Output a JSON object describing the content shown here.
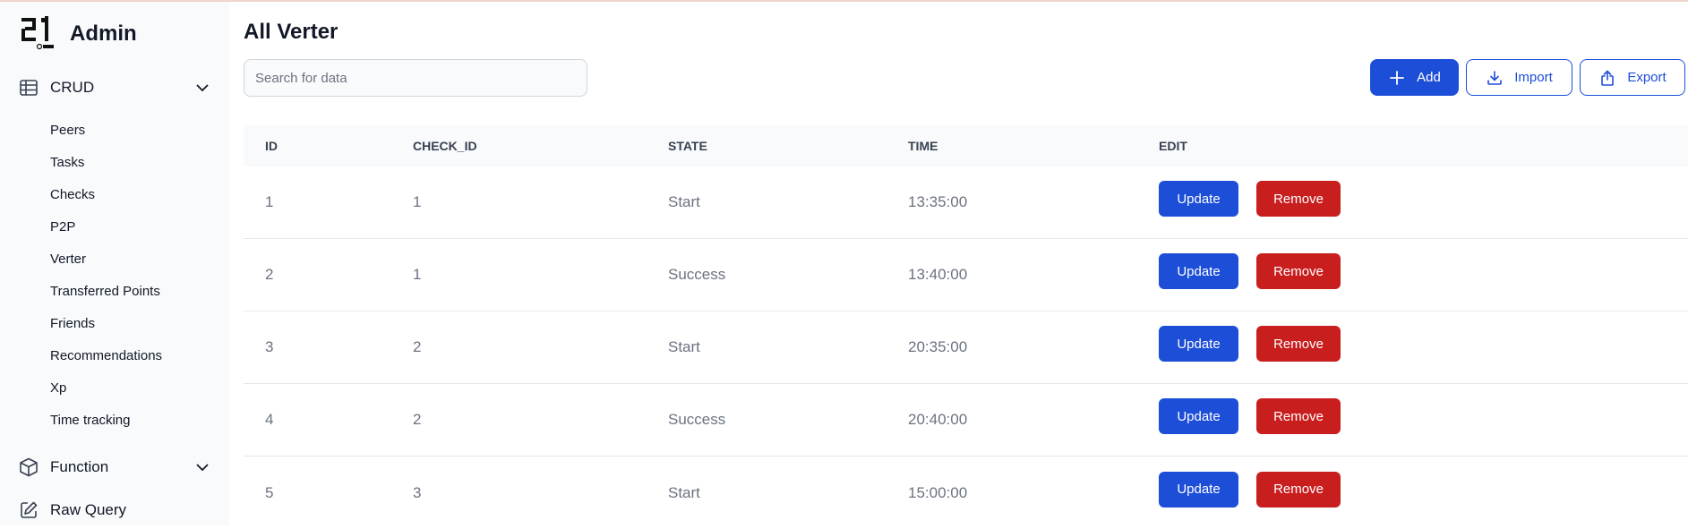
{
  "brand": {
    "title": "Admin"
  },
  "sidebar": {
    "crud": {
      "label": "CRUD",
      "items": [
        {
          "label": "Peers"
        },
        {
          "label": "Tasks"
        },
        {
          "label": "Checks"
        },
        {
          "label": "P2P"
        },
        {
          "label": "Verter"
        },
        {
          "label": "Transferred Points"
        },
        {
          "label": "Friends"
        },
        {
          "label": "Recommendations"
        },
        {
          "label": "Xp"
        },
        {
          "label": "Time tracking"
        }
      ]
    },
    "function": {
      "label": "Function"
    },
    "raw_query": {
      "label": "Raw Query"
    }
  },
  "main": {
    "title": "All Verter",
    "search": {
      "placeholder": "Search for data",
      "value": ""
    },
    "buttons": {
      "add": "Add",
      "import": "Import",
      "export": "Export"
    },
    "table": {
      "headers": [
        "ID",
        "CHECK_ID",
        "STATE",
        "TIME",
        "EDIT"
      ],
      "rows": [
        {
          "id": "1",
          "check_id": "1",
          "state": "Start",
          "time": "13:35:00"
        },
        {
          "id": "2",
          "check_id": "1",
          "state": "Success",
          "time": "13:40:00"
        },
        {
          "id": "3",
          "check_id": "2",
          "state": "Start",
          "time": "20:35:00"
        },
        {
          "id": "4",
          "check_id": "2",
          "state": "Success",
          "time": "20:40:00"
        },
        {
          "id": "5",
          "check_id": "3",
          "state": "Start",
          "time": "15:00:00"
        }
      ],
      "update_label": "Update",
      "remove_label": "Remove"
    }
  },
  "colors": {
    "primary": "#1d4ed8",
    "danger": "#c81e1e",
    "sidebar_bg": "#f9fafb"
  }
}
